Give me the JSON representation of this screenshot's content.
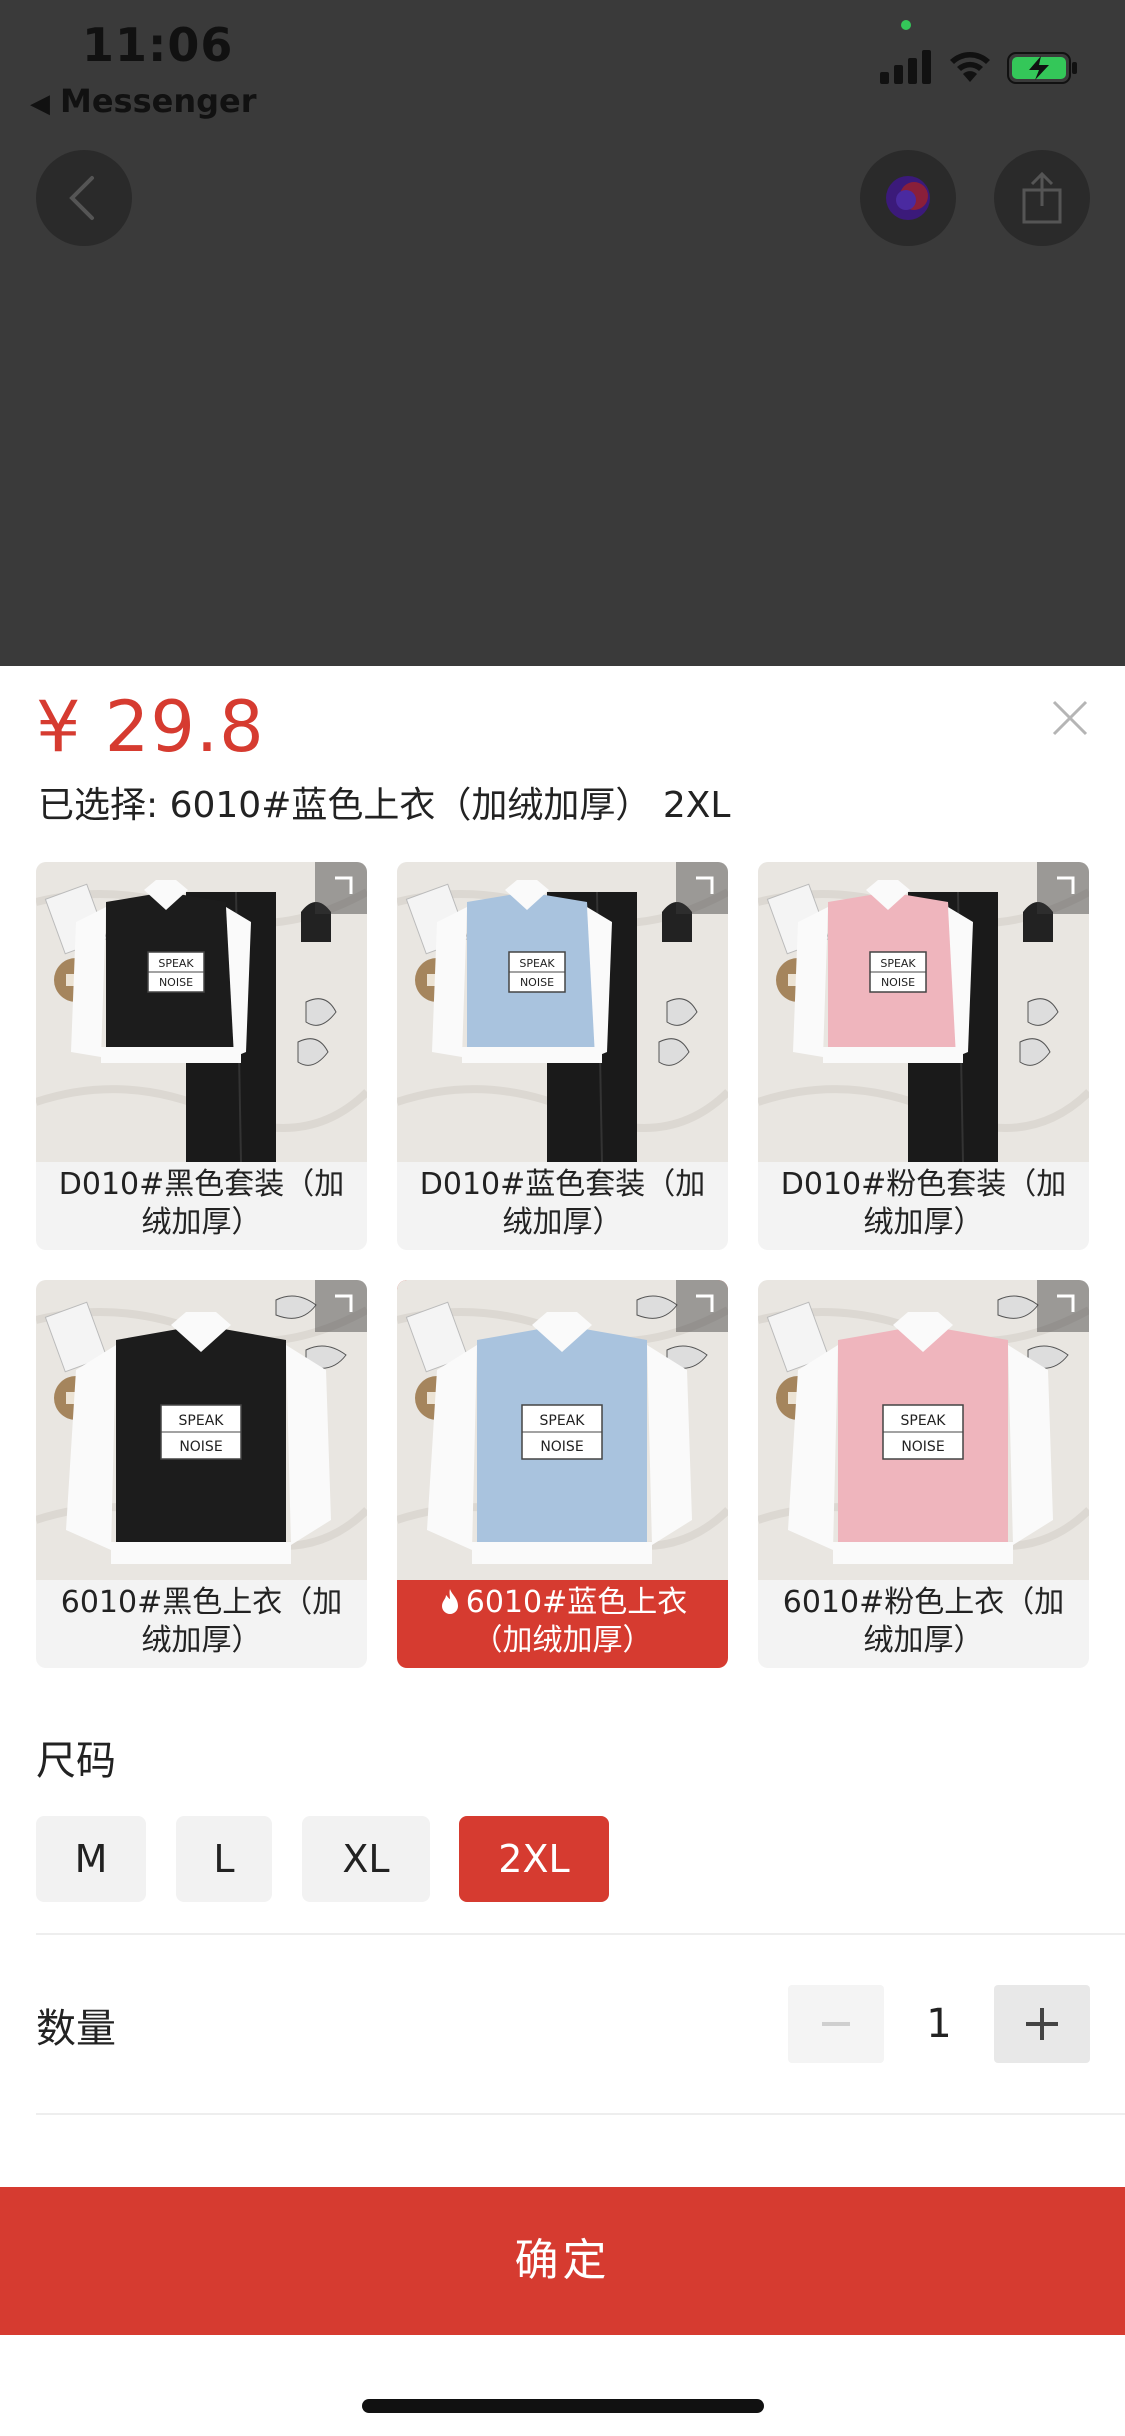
{
  "status_bar": {
    "time": "11:06",
    "back_app": "Messenger"
  },
  "product": {
    "price": "¥ 29.8",
    "selected_prefix": "已选择:",
    "selected_value": "6010#蓝色上衣（加绒加厚） 2XL"
  },
  "variants": [
    {
      "label": "D010#黑色套装（加绒加厚）",
      "shirt_color": "#1c1c1c",
      "has_pants": true,
      "selected": false
    },
    {
      "label": "D010#蓝色套装（加绒加厚）",
      "shirt_color": "#a9c3de",
      "has_pants": true,
      "selected": false
    },
    {
      "label": "D010#粉色套装（加绒加厚）",
      "shirt_color": "#efb5bd",
      "has_pants": true,
      "selected": false
    },
    {
      "label": "6010#黑色上衣（加绒加厚）",
      "shirt_color": "#1c1c1c",
      "has_pants": false,
      "selected": false
    },
    {
      "label": "6010#蓝色上衣（加绒加厚）",
      "shirt_color": "#a9c3de",
      "has_pants": false,
      "selected": true
    },
    {
      "label": "6010#粉色上衣（加绒加厚）",
      "shirt_color": "#efb5bd",
      "has_pants": false,
      "selected": false
    }
  ],
  "print_text": {
    "line1": "SPEAK",
    "line2": "NOISE"
  },
  "size": {
    "title": "尺码",
    "options": [
      "M",
      "L",
      "XL",
      "2XL"
    ],
    "selected": "2XL"
  },
  "quantity": {
    "label": "数量",
    "value": "1",
    "minus_icon": "minus-icon",
    "plus_icon": "plus-icon"
  },
  "confirm_label": "确定",
  "colors": {
    "accent": "#d63b30",
    "overlay": "#3a3a3a"
  }
}
